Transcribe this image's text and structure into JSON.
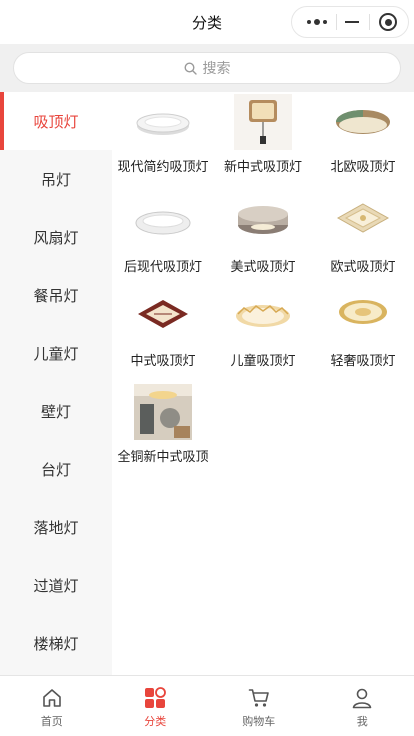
{
  "navbar": {
    "title": "分类"
  },
  "search": {
    "placeholder": "搜索"
  },
  "sidebar": {
    "items": [
      {
        "label": "吸顶灯",
        "active": true
      },
      {
        "label": "吊灯"
      },
      {
        "label": "风扇灯"
      },
      {
        "label": "餐吊灯"
      },
      {
        "label": "儿童灯"
      },
      {
        "label": "壁灯"
      },
      {
        "label": "台灯"
      },
      {
        "label": "落地灯"
      },
      {
        "label": "过道灯"
      },
      {
        "label": "楼梯灯"
      }
    ]
  },
  "products": [
    {
      "name": "现代简约吸顶灯",
      "image": "round-white-ceiling-lamp-icon"
    },
    {
      "name": "新中式吸顶灯",
      "image": "chinese-lantern-lamp-icon"
    },
    {
      "name": "北欧吸顶灯",
      "image": "nordic-wood-ceiling-lamp-icon"
    },
    {
      "name": "后现代吸顶灯",
      "image": "postmodern-white-ceiling-lamp-icon"
    },
    {
      "name": "美式吸顶灯",
      "image": "american-silver-ceiling-lamp-icon"
    },
    {
      "name": "欧式吸顶灯",
      "image": "european-crystal-square-lamp-icon"
    },
    {
      "name": "中式吸顶灯",
      "image": "chinese-square-wood-lamp-icon"
    },
    {
      "name": "儿童吸顶灯",
      "image": "kids-crown-ceiling-lamp-icon"
    },
    {
      "name": "轻奢吸顶灯",
      "image": "luxury-gold-ceiling-lamp-icon"
    },
    {
      "name": "全铜新中式吸顶",
      "image": "copper-new-chinese-room-icon"
    }
  ],
  "tabbar": {
    "items": [
      {
        "label": "首页",
        "icon": "home-icon"
      },
      {
        "label": "分类",
        "icon": "category-icon",
        "active": true
      },
      {
        "label": "购物车",
        "icon": "cart-icon"
      },
      {
        "label": "我",
        "icon": "user-icon"
      }
    ]
  },
  "colors": {
    "accent": "#e8453c",
    "sidebar_bg": "#f7f7f7",
    "search_bg": "#f0f0f0"
  }
}
